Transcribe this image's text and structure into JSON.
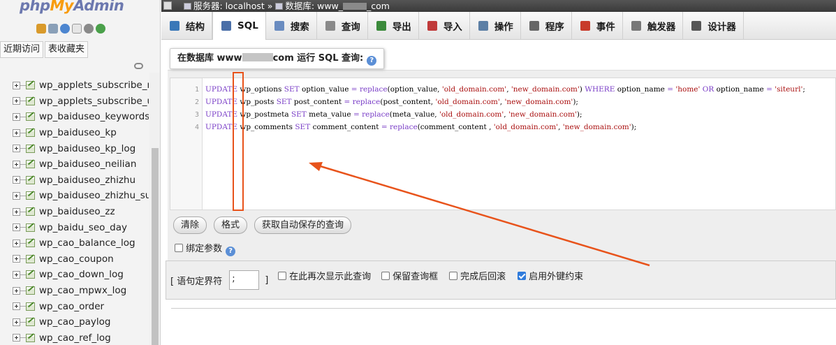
{
  "logo": {
    "php": "php",
    "my": "My",
    "admin": "Admin"
  },
  "nav": {
    "icons": [
      "home-icon",
      "exit-icon",
      "help-icon",
      "docs-icon",
      "settings-icon",
      "reload-icon"
    ],
    "recent_label": "近期访问",
    "favorites_label": "表收藏夹",
    "tables": [
      "wp_applets_subscribe_m",
      "wp_applets_subscribe_us",
      "wp_baiduseo_keywords",
      "wp_baiduseo_kp",
      "wp_baiduseo_kp_log",
      "wp_baiduseo_neilian",
      "wp_baiduseo_zhizhu",
      "wp_baiduseo_zhizhu_suc",
      "wp_baiduseo_zz",
      "wp_baidu_seo_day",
      "wp_cao_balance_log",
      "wp_cao_coupon",
      "wp_cao_down_log",
      "wp_cao_mpwx_log",
      "wp_cao_order",
      "wp_cao_paylog",
      "wp_cao_ref_log"
    ]
  },
  "breadcrumb": {
    "server": "服务器: localhost",
    "sep": "»",
    "db_prefix": "数据库: www_",
    "db_suffix": "_com"
  },
  "tabs": [
    {
      "label": "结构",
      "icon": "structure-icon",
      "color": "#3a78b8"
    },
    {
      "label": "SQL",
      "icon": "sql-icon",
      "color": "#4a6fa8",
      "active": true
    },
    {
      "label": "搜索",
      "icon": "search-icon",
      "color": "#6a8cc0"
    },
    {
      "label": "查询",
      "icon": "query-icon",
      "color": "#8a8a8a"
    },
    {
      "label": "导出",
      "icon": "export-icon",
      "color": "#3b8a3b"
    },
    {
      "label": "导入",
      "icon": "import-icon",
      "color": "#c03a3a"
    },
    {
      "label": "操作",
      "icon": "operations-icon",
      "color": "#5c7fa5"
    },
    {
      "label": "程序",
      "icon": "routines-icon",
      "color": "#666666"
    },
    {
      "label": "事件",
      "icon": "events-icon",
      "color": "#c83b2a"
    },
    {
      "label": "触发器",
      "icon": "triggers-icon",
      "color": "#777777"
    },
    {
      "label": "设计器",
      "icon": "designer-icon",
      "color": "#555555"
    }
  ],
  "sql_panel": {
    "title_prefix": "在数据库 www",
    "title_suffix": "com 运行 SQL 查询:",
    "line_numbers": [
      "1",
      "2",
      "3",
      "4"
    ],
    "code_lines": [
      "UPDATE wp_options SET option_value = replace(option_value, 'old_domain.com', 'new_domain.com') WHERE option_name = 'home' OR option_name = 'siteurl';",
      "UPDATE wp_posts SET post_content = replace(post_content, 'old_domain.com', 'new_domain.com');",
      "UPDATE wp_postmeta SET meta_value = replace(meta_value, 'old_domain.com', 'new_domain.com');",
      "UPDATE wp_comments SET comment_content = replace(comment_content , 'old_domain.com', 'new_domain.com');"
    ],
    "buttons": {
      "clear": "清除",
      "format": "格式",
      "autosave": "获取自动保存的查询"
    },
    "bind_params": "绑定参数"
  },
  "options": {
    "delimiter_label_open": "[ 语句定界符",
    "delimiter_value": ";",
    "delimiter_label_close": "]",
    "show_again": "在此再次显示此查询",
    "keep_box": "保留查询框",
    "rollback": "完成后回滚",
    "fk_checks": "启用外键约束",
    "checked": {
      "show_again": false,
      "keep_box": false,
      "rollback": false,
      "fk_checks": true
    }
  },
  "colors": {
    "annotation": "#e8531b",
    "link": "#235a81",
    "accent": "#2f7bdb"
  }
}
